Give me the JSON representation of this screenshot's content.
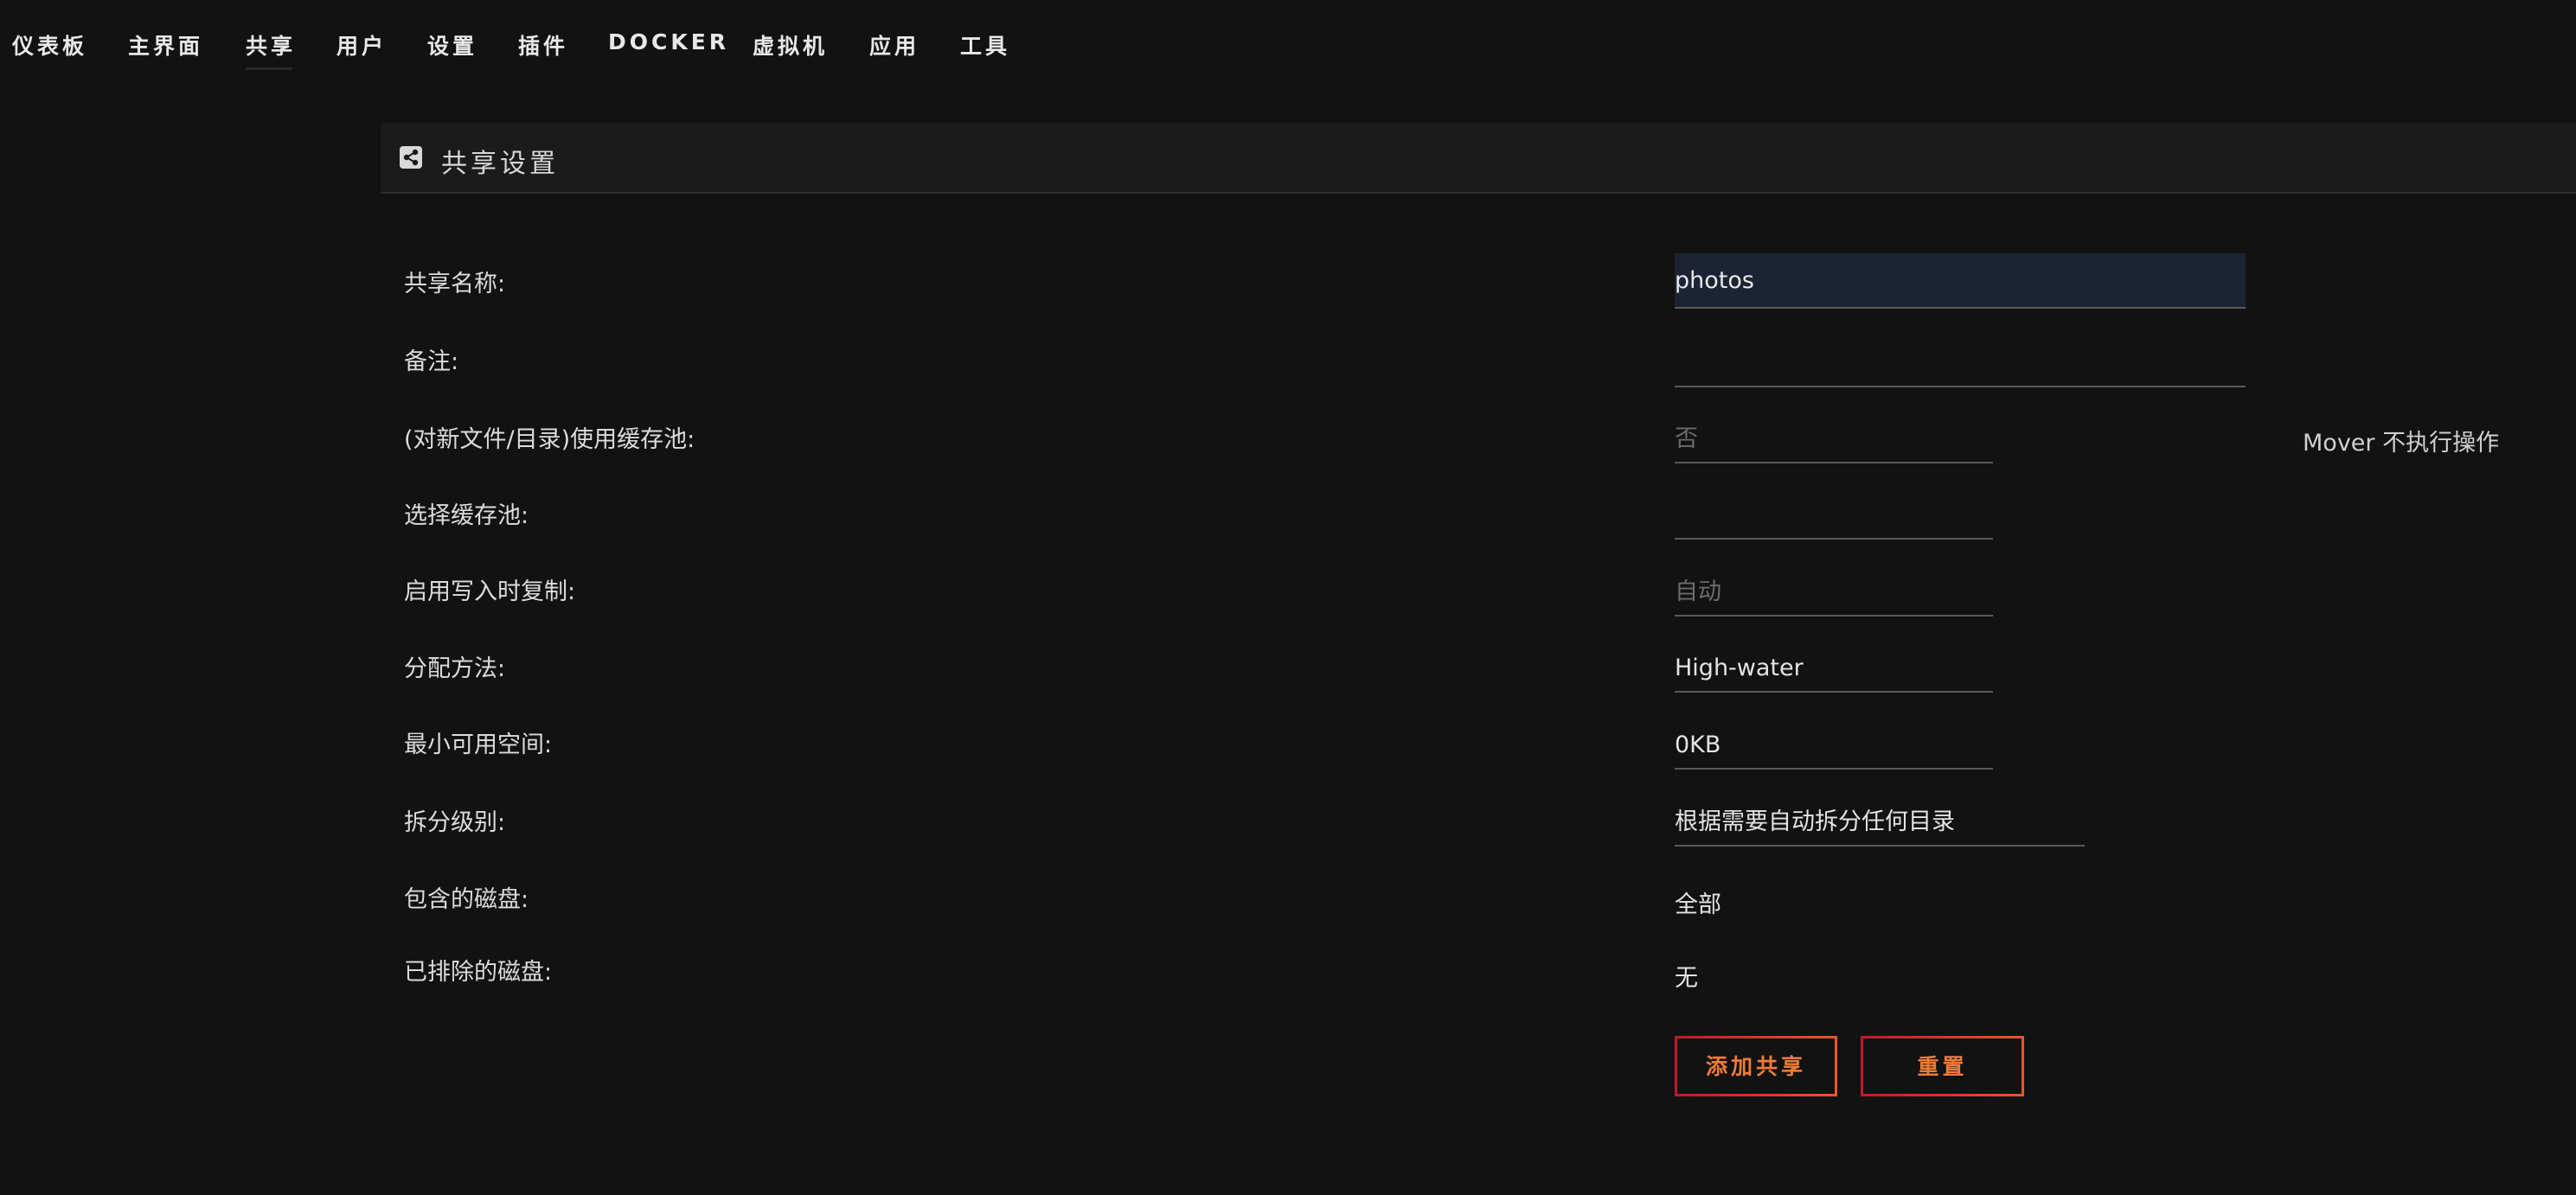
{
  "nav": {
    "items": [
      "仪表板",
      "主界面",
      "共享",
      "用户",
      "设置",
      "插件",
      "DOCKER",
      "虚拟机",
      "应用",
      "工具"
    ],
    "active": "共享"
  },
  "panel": {
    "title": "共享设置",
    "icon": "share-icon"
  },
  "form": {
    "share_name": {
      "label": "共享名称:",
      "value": "photos"
    },
    "comment": {
      "label": "备注:",
      "value": ""
    },
    "use_cache": {
      "label": "(对新文件/目录)使用缓存池:",
      "value": "否",
      "note": "Mover 不执行操作"
    },
    "select_cache": {
      "label": "选择缓存池:",
      "value": ""
    },
    "cow": {
      "label": "启用写入时复制:",
      "value": "自动"
    },
    "allocation": {
      "label": "分配方法:",
      "value": "High-water"
    },
    "min_free": {
      "label": "最小可用空间:",
      "value": "0KB"
    },
    "split_level": {
      "label": "拆分级别:",
      "value": "根据需要自动拆分任何目录"
    },
    "included_disks": {
      "label": "包含的磁盘:",
      "value": "全部"
    },
    "excluded_disks": {
      "label": "已排除的磁盘:",
      "value": "无"
    }
  },
  "buttons": {
    "add": "添加共享",
    "reset": "重置"
  },
  "colors": {
    "background": "#121212",
    "accent": "#f07a3a",
    "border_accent": "#c0192b",
    "input_filled_bg": "#1c2333"
  }
}
